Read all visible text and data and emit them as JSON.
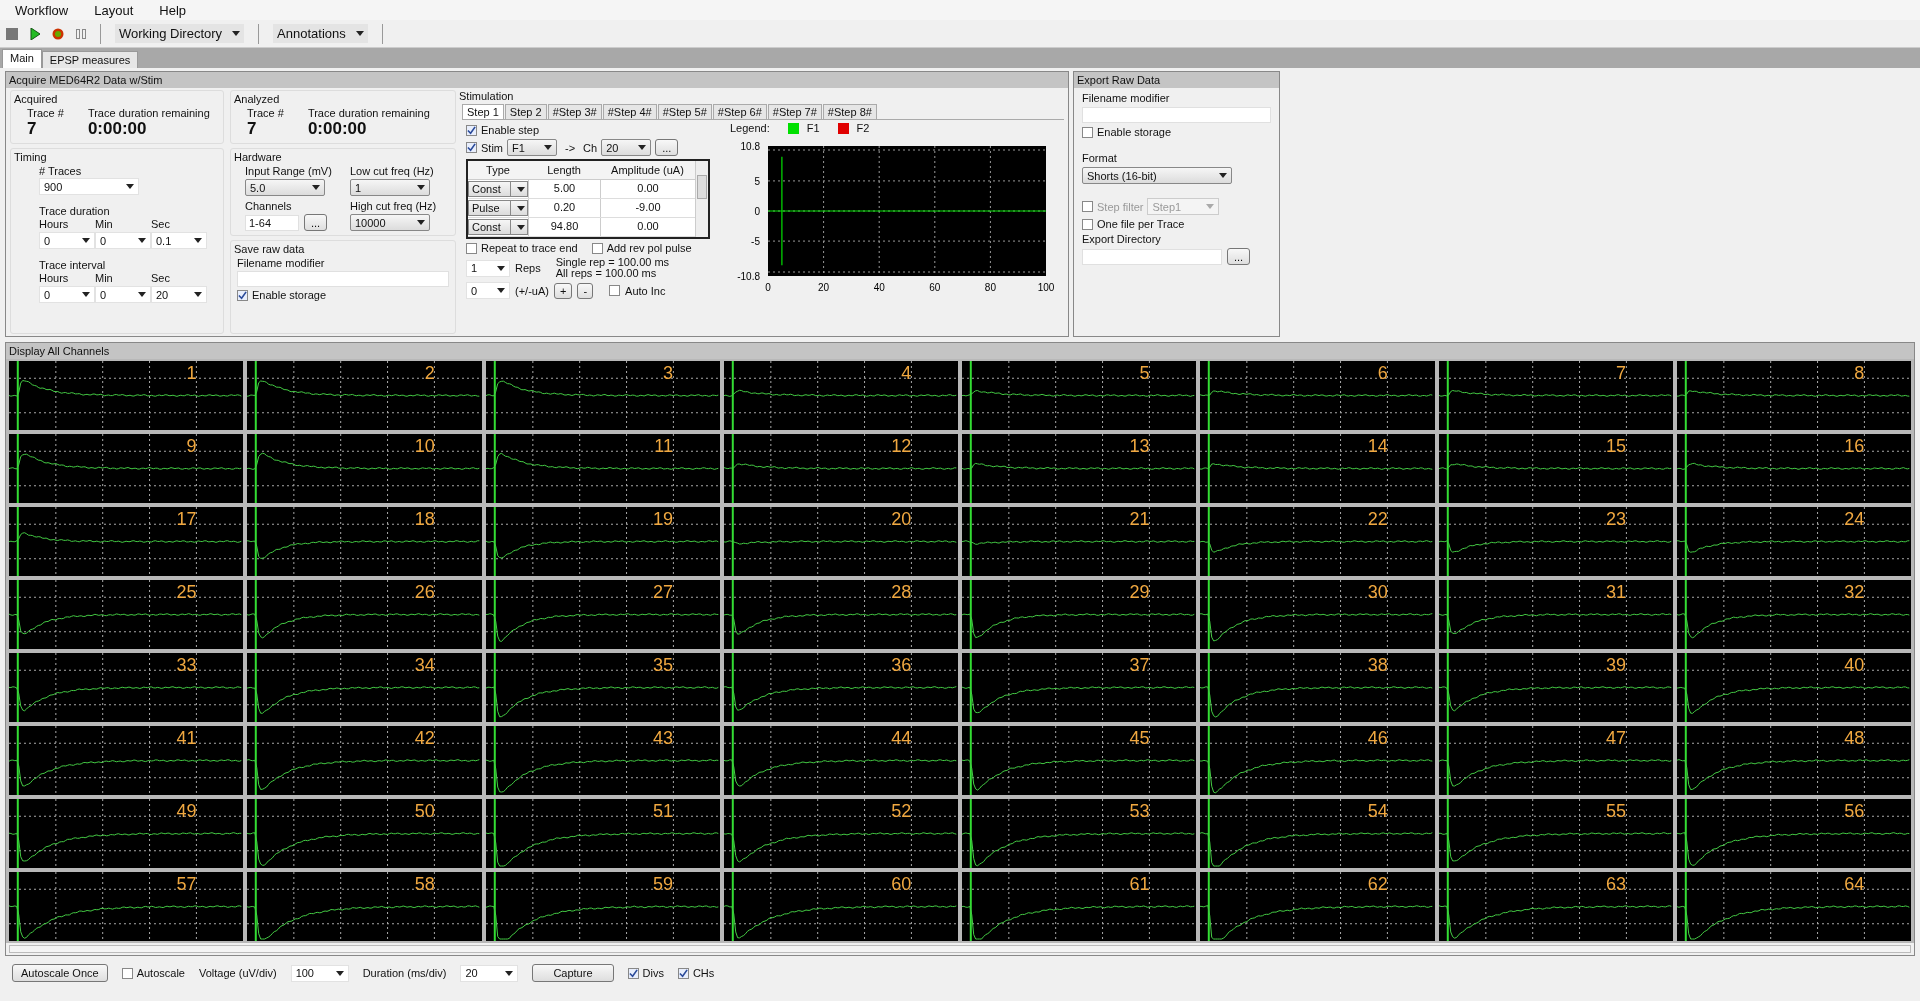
{
  "menu": [
    "Workflow",
    "Layout",
    "Help"
  ],
  "toolbar": {
    "dropdowns": [
      "Working Directory",
      "Annotations"
    ]
  },
  "tabs": [
    {
      "label": "Main",
      "selected": true
    },
    {
      "label": "EPSP measures",
      "selected": false
    }
  ],
  "acquire_panel": {
    "title": "Acquire MED64R2 Data w/Stim",
    "acquired": {
      "title": "Acquired",
      "trace_label": "Trace #",
      "trace_value": "7",
      "remaining_label": "Trace duration remaining",
      "remaining_value": "0:00:00"
    },
    "analyzed": {
      "title": "Analyzed",
      "trace_label": "Trace #",
      "trace_value": "7",
      "remaining_label": "Trace duration remaining",
      "remaining_value": "0:00:00"
    },
    "timing": {
      "title": "Timing",
      "traces_label": "# Traces",
      "traces_value": "900",
      "duration": {
        "label": "Trace duration",
        "fields": [
          {
            "label": "Hours",
            "value": "0"
          },
          {
            "label": "Min",
            "value": "0"
          },
          {
            "label": "Sec",
            "value": "0.1"
          }
        ]
      },
      "interval": {
        "label": "Trace interval",
        "fields": [
          {
            "label": "Hours",
            "value": "0"
          },
          {
            "label": "Min",
            "value": "0"
          },
          {
            "label": "Sec",
            "value": "20"
          }
        ]
      }
    },
    "hardware": {
      "title": "Hardware",
      "input_range_label": "Input Range (mV)",
      "input_range": "5.0",
      "low_cut_label": "Low cut freq (Hz)",
      "low_cut": "1",
      "channels_label": "Channels",
      "channels": "1-64",
      "browse": "...",
      "high_cut_label": "High cut freq (Hz)",
      "high_cut": "10000"
    },
    "save_raw": {
      "title": "Save raw data",
      "filename_label": "Filename modifier",
      "enable_storage": {
        "label": "Enable storage",
        "checked": true
      }
    },
    "stimulation": {
      "title": "Stimulation",
      "step_tabs": [
        {
          "label": "Step 1",
          "selected": true
        },
        {
          "label": "Step 2",
          "selected": false
        },
        {
          "label": "#Step 3#",
          "selected": false
        },
        {
          "label": "#Step 4#",
          "selected": false
        },
        {
          "label": "#Step 5#",
          "selected": false
        },
        {
          "label": "#Step 6#",
          "selected": false
        },
        {
          "label": "#Step 7#",
          "selected": false
        },
        {
          "label": "#Step 8#",
          "selected": false
        }
      ],
      "enable_step": {
        "label": "Enable step",
        "checked": true
      },
      "stim": {
        "label": "Stim",
        "checked": true,
        "source": "F1",
        "arrow": "->",
        "ch_label": "Ch",
        "ch": "20",
        "browse": "..."
      },
      "table": {
        "columns": [
          "Type",
          "Length",
          "Amplitude (uA)"
        ],
        "rows": [
          {
            "type": "Const",
            "length": "5.00",
            "amplitude": "0.00"
          },
          {
            "type": "Pulse",
            "length": "0.20",
            "amplitude": "-9.00"
          },
          {
            "type": "Const",
            "length": "94.80",
            "amplitude": "0.00"
          }
        ]
      },
      "repeat": {
        "label": "Repeat to trace end",
        "checked": false
      },
      "rev_pol": {
        "label": "Add rev pol pulse",
        "checked": false
      },
      "reps": "1",
      "reps_label": "Reps",
      "single_rep": "Single rep = 100.00 ms",
      "all_reps": "All reps = 100.00 ms",
      "increment": "0",
      "increment_label": "(+/-uA)",
      "plus": "+",
      "minus": "-",
      "auto_inc": {
        "label": "Auto Inc",
        "checked": false
      },
      "legend_label": "Legend:",
      "legend": [
        {
          "label": "F1",
          "color": "#00e000"
        },
        {
          "label": "F2",
          "color": "#e00000"
        }
      ],
      "chart_data": {
        "type": "line",
        "x": [
          0,
          5,
          5,
          5,
          5,
          100
        ],
        "series": [
          {
            "color": "#00e000",
            "values": [
              0,
              0,
              9,
              -9,
              0,
              0
            ]
          }
        ],
        "grid": true,
        "xlim": [
          0,
          100
        ],
        "ylim": [
          -10.8,
          10.8
        ],
        "xticks": [
          0,
          20,
          40,
          60,
          80,
          100
        ],
        "yticks": [
          10.8,
          5,
          0,
          -5,
          -10.8
        ]
      }
    }
  },
  "export_panel": {
    "title": "Export Raw Data",
    "filename_label": "Filename modifier",
    "enable_storage": {
      "label": "Enable storage",
      "checked": false
    },
    "format_label": "Format",
    "format": "Shorts (16-bit)",
    "step_filter": {
      "label": "Step filter",
      "checked": false,
      "value": "Step1",
      "disabled": true
    },
    "one_file": {
      "label": "One file per Trace",
      "checked": false
    },
    "directory_label": "Export Directory",
    "browse": "..."
  },
  "display": {
    "title": "Display All Channels",
    "channels": [
      "1",
      "2",
      "3",
      "4",
      "5",
      "6",
      "7",
      "8",
      "9",
      "10",
      "11",
      "12",
      "13",
      "14",
      "15",
      "16",
      "17",
      "18",
      "19",
      "20",
      "21",
      "22",
      "23",
      "24",
      "25",
      "26",
      "27",
      "28",
      "29",
      "30",
      "31",
      "32",
      "33",
      "34",
      "35",
      "36",
      "37",
      "38",
      "39",
      "40",
      "41",
      "42",
      "43",
      "44",
      "45",
      "46",
      "47",
      "48",
      "49",
      "50",
      "51",
      "52",
      "53",
      "54",
      "55",
      "56",
      "57",
      "58",
      "59",
      "60",
      "61",
      "62",
      "63",
      "64"
    ]
  },
  "bottom_bar": {
    "autoscale_once": "Autoscale Once",
    "autoscale": {
      "label": "Autoscale",
      "checked": false
    },
    "voltage_label": "Voltage (uV/div)",
    "voltage": "100",
    "duration_label": "Duration (ms/div)",
    "duration": "20",
    "capture": "Capture",
    "divs": {
      "label": "Divs",
      "checked": true
    },
    "chs": {
      "label": "CHs",
      "checked": true
    }
  }
}
